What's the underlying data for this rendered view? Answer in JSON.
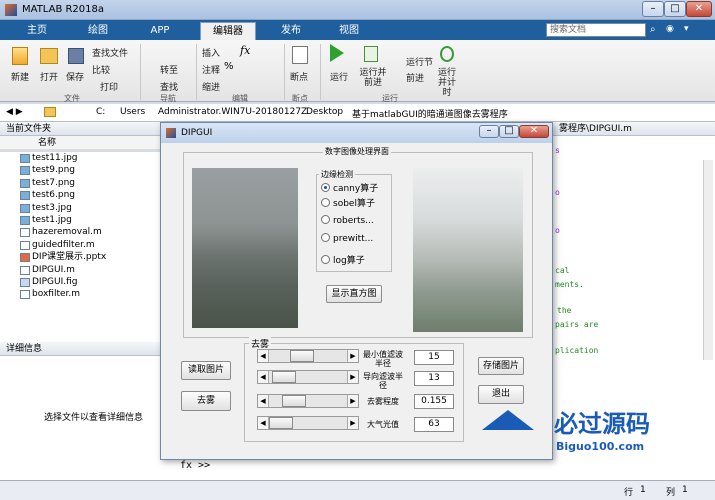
{
  "window": {
    "title": "MATLAB R2018a"
  },
  "tabs": [
    "主页",
    "绘图",
    "APP",
    "编辑器",
    "发布",
    "视图"
  ],
  "active_tab": "编辑器",
  "search": {
    "placeholder": "搜索文档"
  },
  "toolstrip": {
    "file": {
      "new": "新建",
      "open": "打开",
      "save": "保存",
      "find_files": "查找文件",
      "compare": "比较",
      "print": "打印",
      "group": "文件"
    },
    "navigate": {
      "goto": "转至",
      "find": "查找",
      "group": "导航"
    },
    "edit": {
      "insert": "插入",
      "comment": "注释",
      "indent": "缩进",
      "group": "编辑"
    },
    "breakpoints": {
      "label": "断点",
      "group": "断点"
    },
    "run": {
      "run": "运行",
      "run_advance": "运行并前进",
      "run_section": "运行节",
      "advance": "前进",
      "run_time": "运行并计时",
      "group": "运行"
    }
  },
  "address": [
    "C:",
    "Users",
    "Administrator.WIN7U-20180127Z",
    "Desktop",
    "基于matlabGUI的暗通道图像去雾程序"
  ],
  "current_folder": {
    "title": "当前文件夹",
    "column": "名称",
    "files": [
      "test11.jpg",
      "test9.png",
      "test7.png",
      "test6.png",
      "test3.jpg",
      "test1.jpg",
      "hazeremoval.m",
      "guidedfilter.m",
      "DIP课堂展示.pptx",
      "DIPGUI.m",
      "DIPGUI.fig",
      "boxfilter.m"
    ]
  },
  "details": {
    "title": "详细信息",
    "hint": "选择文件以查看详细信息"
  },
  "editor": {
    "title_fragment": "雾程序\\DIPGUI.m",
    "lines": [
      "s",
      "o",
      "",
      "",
      "cal",
      "ments.",
      "",
      "the",
      "pairs are",
      "",
      "plication"
    ]
  },
  "command": {
    "prompt": "fx >>"
  },
  "status": {
    "row_label": "行",
    "row": "1",
    "col_label": "列",
    "col": "1"
  },
  "dialog": {
    "title": "DIPGUI",
    "panel_title": "数字图像处理界面",
    "edge": {
      "title": "边缘检测",
      "options": [
        "canny算子",
        "sobel算子",
        "roberts...",
        "prewitt...",
        "log算子"
      ],
      "selected_index": 0
    },
    "histogram_button": "显示直方图",
    "haze": {
      "title": "去雾",
      "sliders": [
        {
          "label": "最小值滤波半径",
          "value": "15",
          "position": 0.2
        },
        {
          "label": "导向滤波半径",
          "value": "13",
          "position": 0.05
        },
        {
          "label": "去雾程度",
          "value": "0.155",
          "position": 0.15
        },
        {
          "label": "大气光值",
          "value": "63",
          "position": 0.0
        }
      ]
    },
    "buttons": {
      "read": "读取图片",
      "dehaze": "去雾",
      "save": "存储图片",
      "exit": "退出"
    }
  },
  "watermark": {
    "text": "必过源码",
    "url": "Biguo100.com"
  },
  "colors": {
    "accent": "#1f5f9e",
    "radio_on": "#1b4f9b",
    "watermark": "#1a5bb8"
  }
}
